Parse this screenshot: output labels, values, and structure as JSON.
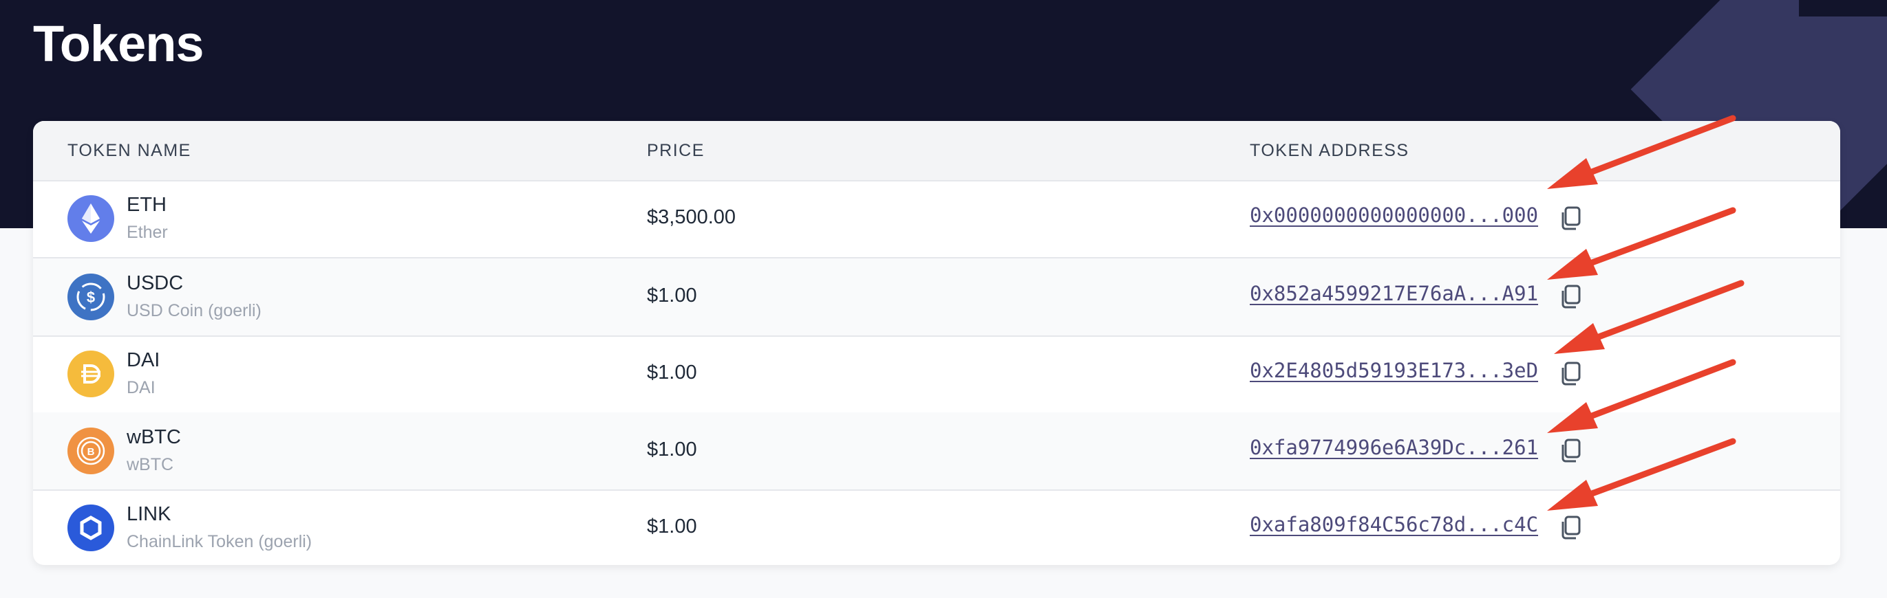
{
  "page": {
    "title": "Tokens"
  },
  "table": {
    "headers": {
      "name": "TOKEN NAME",
      "price": "PRICE",
      "address": "TOKEN ADDRESS"
    },
    "rows": [
      {
        "symbol": "ETH",
        "name": "Ether",
        "price": "$3,500.00",
        "address": "0x0000000000000000...000",
        "icon": "ethereum-icon",
        "color": "#627eea"
      },
      {
        "symbol": "USDC",
        "name": "USD Coin (goerli)",
        "price": "$1.00",
        "address": "0x852a4599217E76aA...A91",
        "icon": "usdc-icon",
        "color": "#3e73c4"
      },
      {
        "symbol": "DAI",
        "name": "DAI",
        "price": "$1.00",
        "address": "0x2E4805d59193E173...3eD",
        "icon": "dai-icon",
        "color": "#f5bb3c"
      },
      {
        "symbol": "wBTC",
        "name": "wBTC",
        "price": "$1.00",
        "address": "0xfa9774996e6A39Dc...261",
        "icon": "wbtc-icon",
        "color": "#f09242"
      },
      {
        "symbol": "LINK",
        "name": "ChainLink Token (goerli)",
        "price": "$1.00",
        "address": "0xafa809f84C56c78d...c4C",
        "icon": "chainlink-icon",
        "color": "#2a5ada"
      }
    ]
  },
  "colors": {
    "hero_bg": "#12142b",
    "annotation_arrow": "#e8412c",
    "link": "#4d4a7a"
  }
}
